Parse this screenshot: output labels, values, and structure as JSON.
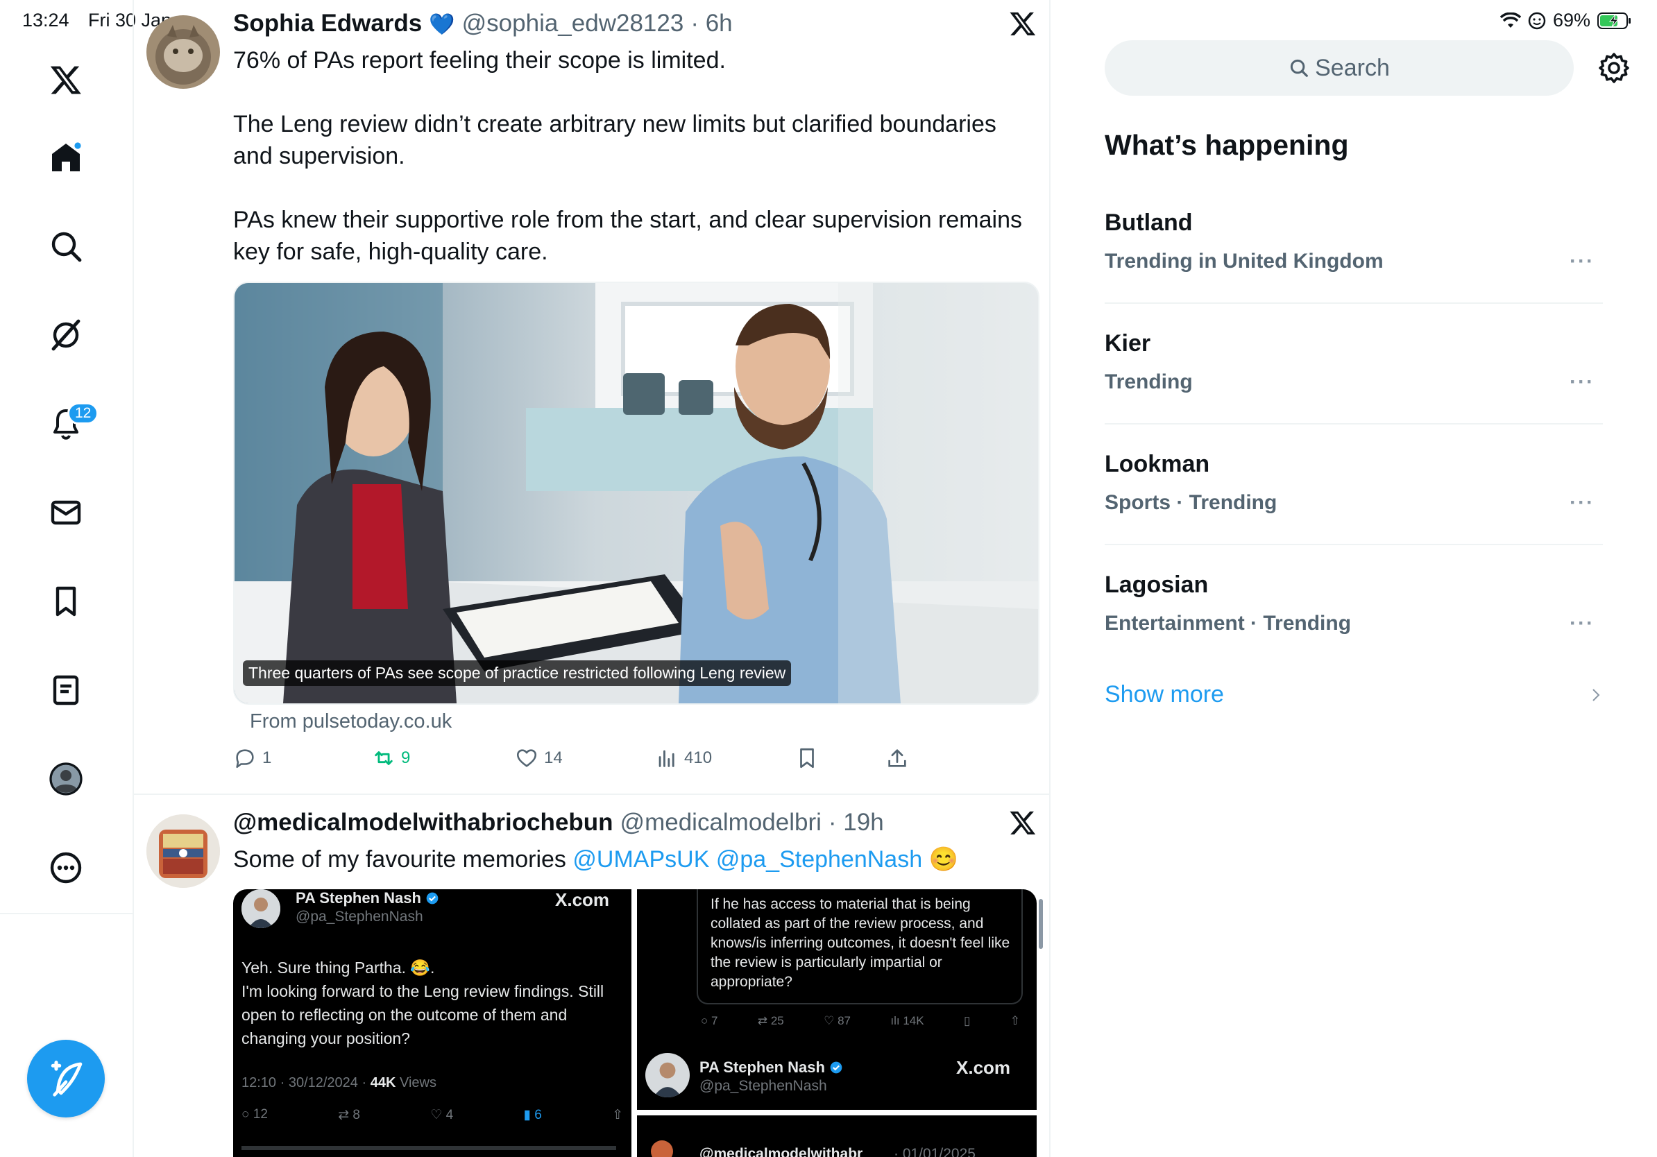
{
  "status_bar": {
    "time": "13:24",
    "date": "Fri 30 Jan",
    "battery": "69%"
  },
  "nav": {
    "notifications_badge": "12"
  },
  "tweet1": {
    "name": "Sophia Edwards",
    "verified_emoji": "💙",
    "handle": "@sophia_edw28123",
    "time": "· 6h",
    "text": "76% of PAs report feeling their scope is limited.\n\nThe Leng review didn’t create arbitrary new limits but clarified boundaries and supervision.\n\nPAs knew their supportive role from the start, and clear supervision remains key for safe, high-quality care.",
    "card_caption": "Three quarters of PAs see scope of practice restricted following Leng review",
    "card_source": "From pulsetoday.co.uk",
    "replies": "1",
    "reposts": "9",
    "likes": "14",
    "views": "410"
  },
  "tweet2": {
    "name": "@medicalmodelwithabriochebun",
    "handle": "@medicalmodelbri",
    "time": "· 19h",
    "text_start": "Some of my favourite memories ",
    "mention1": "@UMAPsUK",
    "mention2": "@pa_StephenNash",
    "emoji": "😊",
    "embed_left": {
      "name": "PA Stephen Nash",
      "handle": "@pa_StephenNash",
      "brand": "X.com",
      "text": "Yeh. Sure thing Partha. 😂.\nI'm looking forward to the Leng review findings. Still open to reflecting on the outcome of them and changing your position?",
      "timestamp": "12:10 · 30/12/2024 · ",
      "views_count": "44K",
      "views_label": " Views",
      "replies": "12",
      "reposts": "8",
      "likes": "4",
      "bookmarks": "6"
    },
    "embed_right": {
      "quote": "If he has access to material that is being collated as part of the review process, and knows/is inferring outcomes, it doesn't feel like the review is particularly impartial or appropriate?",
      "replies": "7",
      "reposts": "25",
      "likes": "87",
      "views": "14K",
      "name": "PA Stephen Nash",
      "handle": "@pa_StephenNash",
      "brand": "X.com",
      "bottom_name": "@medicalmodelwithabr",
      "bottom_date": "· 01/01/2025"
    }
  },
  "sidebar": {
    "search_placeholder": "Search",
    "heading": "What’s happening",
    "trends": [
      {
        "title": "Butland",
        "sub": "Trending in United Kingdom"
      },
      {
        "title": "Kier",
        "sub": "Trending"
      },
      {
        "title": "Lookman",
        "sub": "Sports · Trending"
      },
      {
        "title": "Lagosian",
        "sub": "Entertainment · Trending"
      }
    ],
    "more_label": "···",
    "show_more": "Show more"
  },
  "colors": {
    "accent": "#1d9bf0",
    "repost_green": "#00ba7c",
    "text": "#0f1419",
    "muted": "#536471"
  }
}
